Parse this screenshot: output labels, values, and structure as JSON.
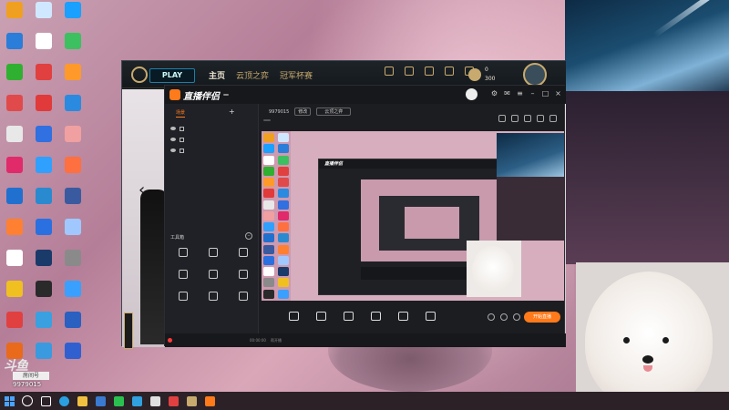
{
  "desktop": {
    "icons": [
      {
        "label": "",
        "color": "#f0a020"
      },
      {
        "label": "",
        "color": "#d0e8ff"
      },
      {
        "label": "",
        "color": "#1aa0ff"
      },
      {
        "label": "",
        "color": "#2a7dd8"
      },
      {
        "label": "",
        "color": "#ffffff"
      },
      {
        "label": "",
        "color": "#3cc060"
      },
      {
        "label": "",
        "color": "#30b030"
      },
      {
        "label": "",
        "color": "#e04040"
      },
      {
        "label": "",
        "color": "#ff9a2a"
      },
      {
        "label": "",
        "color": "#e04a4a"
      },
      {
        "label": "",
        "color": "#e03a3a"
      },
      {
        "label": "",
        "color": "#2a8ae0"
      },
      {
        "label": "",
        "color": "#e8e8e8"
      },
      {
        "label": "",
        "color": "#3070e0"
      },
      {
        "label": "",
        "color": "#f0a0a0"
      },
      {
        "label": "",
        "color": "#e02a6a"
      },
      {
        "label": "",
        "color": "#30a0ff"
      },
      {
        "label": "",
        "color": "#ff7040"
      },
      {
        "label": "",
        "color": "#2070d0"
      },
      {
        "label": "",
        "color": "#2a8ad0"
      },
      {
        "label": "",
        "color": "#3a5aa0"
      },
      {
        "label": "",
        "color": "#ff8030"
      },
      {
        "label": "",
        "color": "#2a70e0"
      },
      {
        "label": "",
        "color": "#a0c8ff"
      },
      {
        "label": "",
        "color": "#ffffff"
      },
      {
        "label": "",
        "color": "#1a3a6a"
      },
      {
        "label": "",
        "color": "#8a8a8a"
      },
      {
        "label": "",
        "color": "#f0c020"
      },
      {
        "label": "",
        "color": "#2a2a2a"
      },
      {
        "label": "",
        "color": "#3aa0ff"
      },
      {
        "label": "",
        "color": "#e04040"
      },
      {
        "label": "",
        "color": "#3aa0e0"
      },
      {
        "label": "",
        "color": "#2a60c0"
      },
      {
        "label": "",
        "color": "#e86a1a"
      },
      {
        "label": "",
        "color": "#3a9ae0"
      },
      {
        "label": "",
        "color": "#3060d0"
      },
      {
        "label": "",
        "color": "#f0d020"
      },
      {
        "label": "",
        "color": "#30c060"
      },
      {
        "label": "",
        "color": "#ff6a2a"
      },
      {
        "label": "",
        "color": "#e0a030"
      },
      {
        "label": "",
        "color": "#3a3a3a"
      },
      {
        "label": "",
        "color": "#c0c0c0"
      }
    ]
  },
  "overlay": {
    "brand": "斗鱼",
    "room_label": "房间号",
    "room_number": "9979015"
  },
  "lol": {
    "play_label": "PLAY",
    "nav": [
      "主页",
      "云顶之弈",
      "冠军杯赛"
    ],
    "currency_top": "0",
    "currency_bottom": "300",
    "accent": "#c8aa6e"
  },
  "stream_app": {
    "brand": "直播伴侣",
    "version_badge": "",
    "accent": "#ff7a1a",
    "tabs": [
      "场景",
      "",
      ""
    ],
    "scenes": [
      "",
      "",
      ""
    ],
    "tools_title": "工具箱",
    "tools": [
      "",
      "",
      "",
      "",
      "",
      "",
      "",
      "",
      ""
    ],
    "title_line": "",
    "room_id": "9979015",
    "edit_label": "修改",
    "category": "云顶之弈",
    "tags": [
      "",
      "",
      "",
      ""
    ],
    "controls": [
      "",
      "",
      "",
      "",
      "",
      ""
    ],
    "go_live": "开始直播",
    "status_notice": "",
    "status_items": [
      "",
      "",
      "",
      "",
      "",
      "",
      "00:00:00",
      "帮开播"
    ]
  }
}
